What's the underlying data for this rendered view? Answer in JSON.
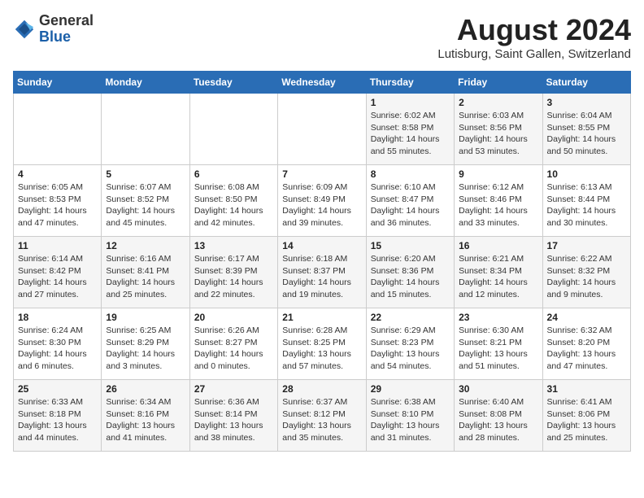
{
  "header": {
    "logo_general": "General",
    "logo_blue": "Blue",
    "month_title": "August 2024",
    "location": "Lutisburg, Saint Gallen, Switzerland"
  },
  "weekdays": [
    "Sunday",
    "Monday",
    "Tuesday",
    "Wednesday",
    "Thursday",
    "Friday",
    "Saturday"
  ],
  "weeks": [
    [
      {
        "day": "",
        "info": ""
      },
      {
        "day": "",
        "info": ""
      },
      {
        "day": "",
        "info": ""
      },
      {
        "day": "",
        "info": ""
      },
      {
        "day": "1",
        "info": "Sunrise: 6:02 AM\nSunset: 8:58 PM\nDaylight: 14 hours and 55 minutes."
      },
      {
        "day": "2",
        "info": "Sunrise: 6:03 AM\nSunset: 8:56 PM\nDaylight: 14 hours and 53 minutes."
      },
      {
        "day": "3",
        "info": "Sunrise: 6:04 AM\nSunset: 8:55 PM\nDaylight: 14 hours and 50 minutes."
      }
    ],
    [
      {
        "day": "4",
        "info": "Sunrise: 6:05 AM\nSunset: 8:53 PM\nDaylight: 14 hours and 47 minutes."
      },
      {
        "day": "5",
        "info": "Sunrise: 6:07 AM\nSunset: 8:52 PM\nDaylight: 14 hours and 45 minutes."
      },
      {
        "day": "6",
        "info": "Sunrise: 6:08 AM\nSunset: 8:50 PM\nDaylight: 14 hours and 42 minutes."
      },
      {
        "day": "7",
        "info": "Sunrise: 6:09 AM\nSunset: 8:49 PM\nDaylight: 14 hours and 39 minutes."
      },
      {
        "day": "8",
        "info": "Sunrise: 6:10 AM\nSunset: 8:47 PM\nDaylight: 14 hours and 36 minutes."
      },
      {
        "day": "9",
        "info": "Sunrise: 6:12 AM\nSunset: 8:46 PM\nDaylight: 14 hours and 33 minutes."
      },
      {
        "day": "10",
        "info": "Sunrise: 6:13 AM\nSunset: 8:44 PM\nDaylight: 14 hours and 30 minutes."
      }
    ],
    [
      {
        "day": "11",
        "info": "Sunrise: 6:14 AM\nSunset: 8:42 PM\nDaylight: 14 hours and 27 minutes."
      },
      {
        "day": "12",
        "info": "Sunrise: 6:16 AM\nSunset: 8:41 PM\nDaylight: 14 hours and 25 minutes."
      },
      {
        "day": "13",
        "info": "Sunrise: 6:17 AM\nSunset: 8:39 PM\nDaylight: 14 hours and 22 minutes."
      },
      {
        "day": "14",
        "info": "Sunrise: 6:18 AM\nSunset: 8:37 PM\nDaylight: 14 hours and 19 minutes."
      },
      {
        "day": "15",
        "info": "Sunrise: 6:20 AM\nSunset: 8:36 PM\nDaylight: 14 hours and 15 minutes."
      },
      {
        "day": "16",
        "info": "Sunrise: 6:21 AM\nSunset: 8:34 PM\nDaylight: 14 hours and 12 minutes."
      },
      {
        "day": "17",
        "info": "Sunrise: 6:22 AM\nSunset: 8:32 PM\nDaylight: 14 hours and 9 minutes."
      }
    ],
    [
      {
        "day": "18",
        "info": "Sunrise: 6:24 AM\nSunset: 8:30 PM\nDaylight: 14 hours and 6 minutes."
      },
      {
        "day": "19",
        "info": "Sunrise: 6:25 AM\nSunset: 8:29 PM\nDaylight: 14 hours and 3 minutes."
      },
      {
        "day": "20",
        "info": "Sunrise: 6:26 AM\nSunset: 8:27 PM\nDaylight: 14 hours and 0 minutes."
      },
      {
        "day": "21",
        "info": "Sunrise: 6:28 AM\nSunset: 8:25 PM\nDaylight: 13 hours and 57 minutes."
      },
      {
        "day": "22",
        "info": "Sunrise: 6:29 AM\nSunset: 8:23 PM\nDaylight: 13 hours and 54 minutes."
      },
      {
        "day": "23",
        "info": "Sunrise: 6:30 AM\nSunset: 8:21 PM\nDaylight: 13 hours and 51 minutes."
      },
      {
        "day": "24",
        "info": "Sunrise: 6:32 AM\nSunset: 8:20 PM\nDaylight: 13 hours and 47 minutes."
      }
    ],
    [
      {
        "day": "25",
        "info": "Sunrise: 6:33 AM\nSunset: 8:18 PM\nDaylight: 13 hours and 44 minutes."
      },
      {
        "day": "26",
        "info": "Sunrise: 6:34 AM\nSunset: 8:16 PM\nDaylight: 13 hours and 41 minutes."
      },
      {
        "day": "27",
        "info": "Sunrise: 6:36 AM\nSunset: 8:14 PM\nDaylight: 13 hours and 38 minutes."
      },
      {
        "day": "28",
        "info": "Sunrise: 6:37 AM\nSunset: 8:12 PM\nDaylight: 13 hours and 35 minutes."
      },
      {
        "day": "29",
        "info": "Sunrise: 6:38 AM\nSunset: 8:10 PM\nDaylight: 13 hours and 31 minutes."
      },
      {
        "day": "30",
        "info": "Sunrise: 6:40 AM\nSunset: 8:08 PM\nDaylight: 13 hours and 28 minutes."
      },
      {
        "day": "31",
        "info": "Sunrise: 6:41 AM\nSunset: 8:06 PM\nDaylight: 13 hours and 25 minutes."
      }
    ]
  ]
}
